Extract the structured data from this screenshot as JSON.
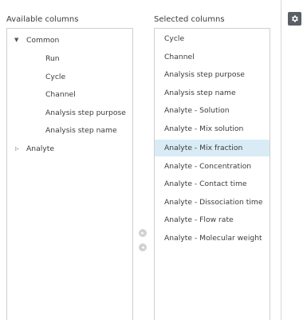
{
  "available": {
    "header": "Available columns",
    "groups": [
      {
        "label": "Common",
        "expanded": true,
        "children": [
          "Run",
          "Cycle",
          "Channel",
          "Analysis step purpose",
          "Analysis step name"
        ]
      },
      {
        "label": "Analyte",
        "expanded": false,
        "children": []
      }
    ]
  },
  "selected": {
    "header": "Selected columns",
    "items": [
      "Cycle",
      "Channel",
      "Analysis step purpose",
      "Analysis step name",
      "Analyte - Solution",
      "Analyte - Mix solution",
      "Analyte - Mix fraction",
      "Analyte - Concentration",
      "Analyte - Contact time",
      "Analyte - Dissociation time",
      "Analyte - Flow rate",
      "Analyte - Molecular weight"
    ],
    "highlighted_item": "Analyte - Mix fraction"
  },
  "icons": {
    "expand": "triangle-down-icon",
    "collapse": "triangle-right-icon",
    "move_right": "arrow-right-circle-icon",
    "move_left": "arrow-left-circle-icon",
    "settings": "gear-icon"
  },
  "colors": {
    "highlight": "#d9ecf6",
    "border": "#cfcfcf",
    "gear_bg": "#5a5f66"
  }
}
